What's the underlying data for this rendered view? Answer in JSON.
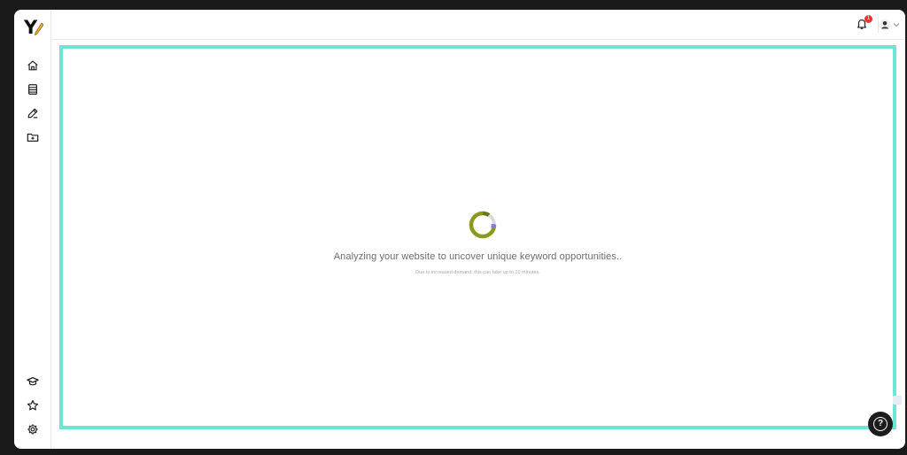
{
  "brand": {
    "logo_letter": "Y",
    "accent": "#6ee6d6"
  },
  "sidebar": {
    "top_items": [
      {
        "icon": "home-icon"
      },
      {
        "icon": "document-list-icon"
      },
      {
        "icon": "pen-icon"
      },
      {
        "icon": "folder-plus-icon"
      }
    ],
    "bottom_items": [
      {
        "icon": "graduation-cap-icon"
      },
      {
        "icon": "star-icon"
      },
      {
        "icon": "gear-icon"
      }
    ]
  },
  "header": {
    "notifications_count": "1",
    "user_icon": "user-icon"
  },
  "main": {
    "loading_title": "Analyzing your website to uncover unique keyword opportunities..",
    "loading_subtitle": "Due to increased demand, this can take up to 10 minutes."
  },
  "help": {
    "label": "?"
  }
}
